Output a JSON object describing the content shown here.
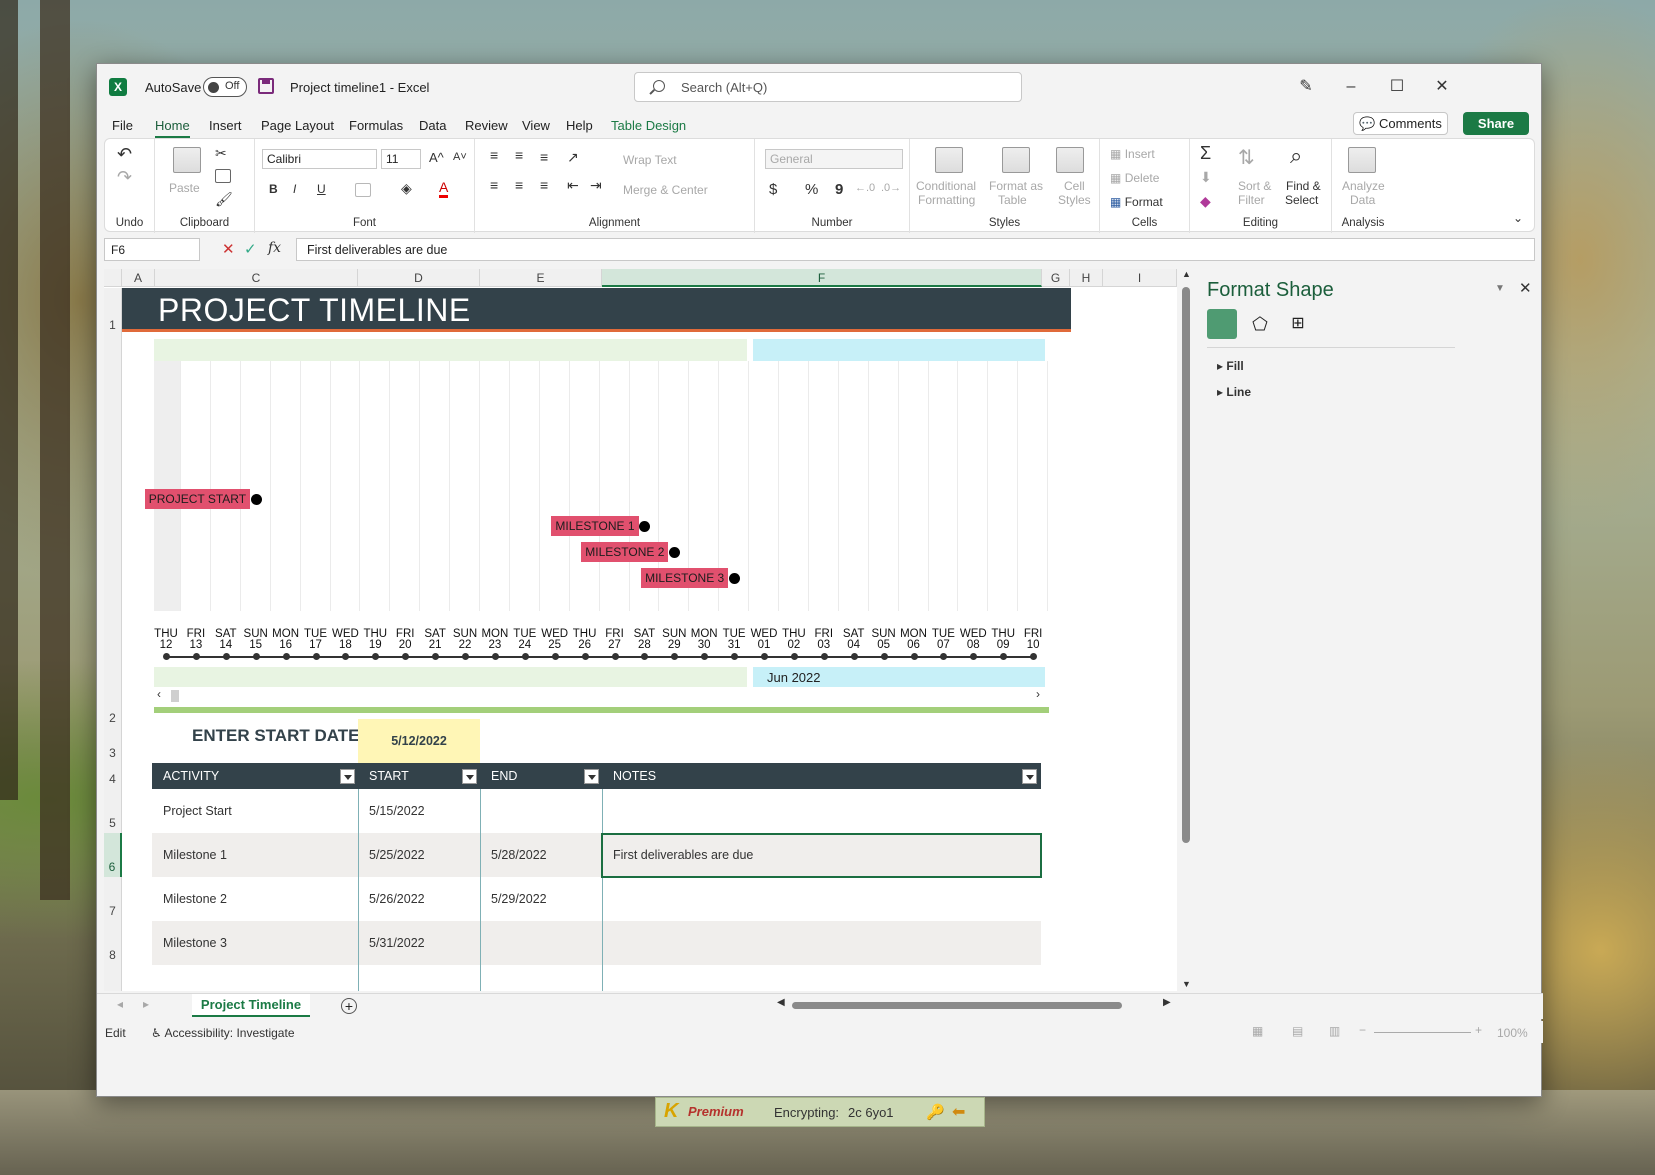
{
  "window": {
    "autosave_label": "AutoSave",
    "autosave_state": "Off",
    "doc_title": "Project timeline1  -  Excel",
    "search_placeholder": "Search (Alt+Q)"
  },
  "menu": {
    "items": [
      "File",
      "Home",
      "Insert",
      "Page Layout",
      "Formulas",
      "Data",
      "Review",
      "View",
      "Help",
      "Table Design"
    ],
    "active": "Home",
    "comments": "Comments",
    "share": "Share"
  },
  "ribbon": {
    "undo_group": "Undo",
    "clipboard": {
      "label": "Clipboard",
      "paste": "Paste"
    },
    "font": {
      "label": "Font",
      "family": "Calibri",
      "size": "11",
      "bold": "B",
      "italic": "I",
      "underline": "U"
    },
    "alignment": {
      "label": "Alignment",
      "wrap": "Wrap Text",
      "merge": "Merge & Center"
    },
    "number": {
      "label": "Number",
      "format": "General",
      "currency": "$",
      "percent": "%",
      "comma": "9"
    },
    "styles": {
      "label": "Styles",
      "conditional_1": "Conditional",
      "conditional_2": "Formatting",
      "format_table_1": "Format as",
      "format_table_2": "Table",
      "cell_styles_1": "Cell",
      "cell_styles_2": "Styles"
    },
    "cells": {
      "label": "Cells",
      "insert": "Insert",
      "delete": "Delete",
      "format": "Format"
    },
    "editing": {
      "label": "Editing",
      "sort_1": "Sort &",
      "sort_2": "Filter",
      "find_1": "Find &",
      "find_2": "Select"
    },
    "analysis": {
      "label": "Analysis",
      "analyze_1": "Analyze",
      "analyze_2": "Data"
    }
  },
  "formula_bar": {
    "name_box": "F6",
    "content": "First deliverables are due"
  },
  "columns": [
    "A",
    "C",
    "D",
    "E",
    "F",
    "G",
    "H",
    "I"
  ],
  "rows": [
    "1",
    "2",
    "3",
    "4",
    "5",
    "6",
    "7",
    "8"
  ],
  "sheet": {
    "title": "PROJECT TIMELINE",
    "start_label": "ENTER START DATE:",
    "start_date": "5/12/2022",
    "month_label": "Jun 2022"
  },
  "timeline": {
    "days": [
      [
        "THU",
        "12"
      ],
      [
        "FRI",
        "13"
      ],
      [
        "SAT",
        "14"
      ],
      [
        "SUN",
        "15"
      ],
      [
        "MON",
        "16"
      ],
      [
        "TUE",
        "17"
      ],
      [
        "WED",
        "18"
      ],
      [
        "THU",
        "19"
      ],
      [
        "FRI",
        "20"
      ],
      [
        "SAT",
        "21"
      ],
      [
        "SUN",
        "22"
      ],
      [
        "MON",
        "23"
      ],
      [
        "TUE",
        "24"
      ],
      [
        "WED",
        "25"
      ],
      [
        "THU",
        "26"
      ],
      [
        "FRI",
        "27"
      ],
      [
        "SAT",
        "28"
      ],
      [
        "SUN",
        "29"
      ],
      [
        "MON",
        "30"
      ],
      [
        "TUE",
        "31"
      ],
      [
        "WED",
        "01"
      ],
      [
        "THU",
        "02"
      ],
      [
        "FRI",
        "03"
      ],
      [
        "SAT",
        "04"
      ],
      [
        "SUN",
        "05"
      ],
      [
        "MON",
        "06"
      ],
      [
        "TUE",
        "07"
      ],
      [
        "WED",
        "08"
      ],
      [
        "THU",
        "09"
      ],
      [
        "FRI",
        "10"
      ]
    ],
    "milestones": [
      {
        "label": "PROJECT START",
        "day_index": 3,
        "level": 0
      },
      {
        "label": "MILESTONE 1",
        "day_index": 16,
        "level": 1
      },
      {
        "label": "MILESTONE 2",
        "day_index": 17,
        "level": 2
      },
      {
        "label": "MILESTONE 3",
        "day_index": 19,
        "level": 3
      }
    ]
  },
  "table": {
    "headers": [
      "ACTIVITY",
      "START",
      "END",
      "NOTES"
    ],
    "rows": [
      [
        "Project Start",
        "5/15/2022",
        "",
        ""
      ],
      [
        "Milestone 1",
        "5/25/2022",
        "5/28/2022",
        "First deliverables are due"
      ],
      [
        "Milestone 2",
        "5/26/2022",
        "5/29/2022",
        ""
      ],
      [
        "Milestone 3",
        "5/31/2022",
        "",
        ""
      ]
    ]
  },
  "format_pane": {
    "title": "Format Shape",
    "sections": [
      "Fill",
      "Line"
    ]
  },
  "tabs": {
    "sheet_name": "Project Timeline"
  },
  "status": {
    "mode": "Edit",
    "accessibility": "Accessibility: Investigate",
    "zoom": "100%"
  },
  "overlay": {
    "brand": "Premium",
    "text": "Encrypting:",
    "code": "2c 6yo1"
  }
}
